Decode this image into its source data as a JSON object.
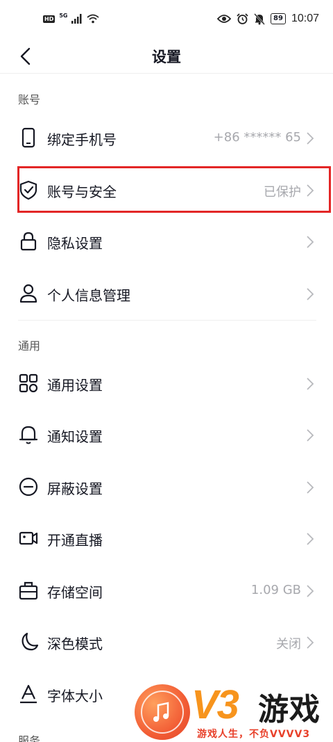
{
  "status_bar": {
    "hd": "HD",
    "network": "5G",
    "battery": "89",
    "time": "10:07",
    "icons": [
      "eye-icon",
      "alarm-icon",
      "mute-bell-icon",
      "battery-icon"
    ]
  },
  "nav": {
    "title": "设置",
    "back_icon": "chevron-left-icon"
  },
  "sections": {
    "account": "账号",
    "general": "通用",
    "service_partial": "服务"
  },
  "account_rows": {
    "phone": {
      "label": "绑定手机号",
      "value": "+86 ****** 65",
      "icon": "phone-icon"
    },
    "security": {
      "label": "账号与安全",
      "value": "已保护",
      "icon": "shield-check-icon"
    },
    "privacy": {
      "label": "隐私设置",
      "value": "",
      "icon": "lock-icon"
    },
    "personal": {
      "label": "个人信息管理",
      "value": "",
      "icon": "person-icon"
    }
  },
  "general_rows": {
    "general_settings": {
      "label": "通用设置",
      "value": "",
      "icon": "grid-icon"
    },
    "notifications": {
      "label": "通知设置",
      "value": "",
      "icon": "bell-icon"
    },
    "block": {
      "label": "屏蔽设置",
      "value": "",
      "icon": "block-icon"
    },
    "live": {
      "label": "开通直播",
      "value": "",
      "icon": "video-camera-icon"
    },
    "storage": {
      "label": "存储空间",
      "value": "1.09 GB",
      "icon": "storage-box-icon"
    },
    "dark_mode": {
      "label": "深色模式",
      "value": "关闭",
      "icon": "moon-icon"
    },
    "font_size": {
      "label": "字体大小",
      "value": "",
      "icon": "font-size-icon"
    }
  },
  "watermark": {
    "brand": "V3",
    "brand_cn": "游戏",
    "slogan": "游戏人生，不负VVVV3"
  },
  "colors": {
    "highlight": "#e32626",
    "text": "#161823",
    "secondary": "#a7a8ad",
    "watermark_orange": "#f7941d"
  }
}
